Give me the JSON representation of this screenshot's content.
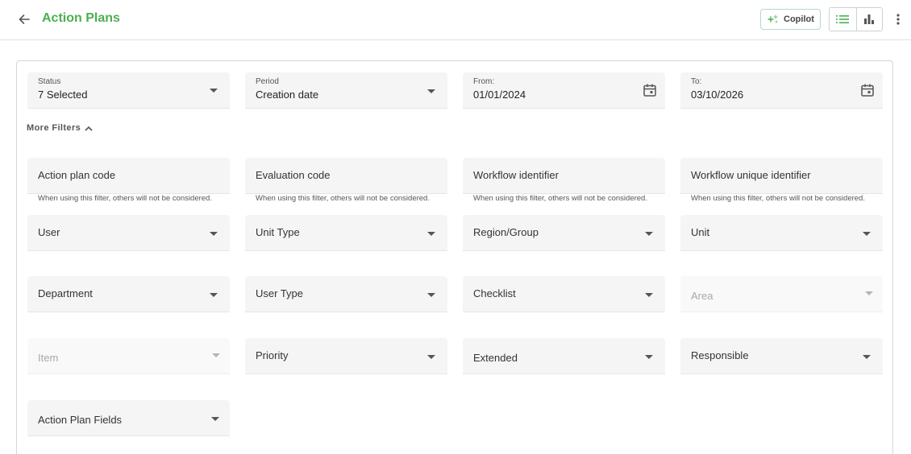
{
  "header": {
    "title": "Action Plans",
    "copilot_label": "Copilot"
  },
  "filters": {
    "status": {
      "label": "Status",
      "value": "7 Selected"
    },
    "period": {
      "label": "Period",
      "value": "Creation date"
    },
    "from": {
      "label": "From:",
      "value": "01/01/2024"
    },
    "to": {
      "label": "To:",
      "value": "03/10/2026"
    },
    "more_filters_label": "More Filters",
    "codes": [
      {
        "label": "Action plan code",
        "hint": "When using this filter, others will not be considered."
      },
      {
        "label": "Evaluation code",
        "hint": "When using this filter, others will not be considered."
      },
      {
        "label": "Workflow identifier",
        "hint": "When using this filter, others will not be considered."
      },
      {
        "label": "Workflow unique identifier",
        "hint": "When using this filter, others will not be considered."
      }
    ],
    "selects": {
      "user": "User",
      "unit_type": "Unit Type",
      "region_group": "Region/Group",
      "unit": "Unit",
      "department": "Department",
      "user_type": "User Type",
      "checklist": "Checklist",
      "area": "Area",
      "item": "Item",
      "priority": "Priority",
      "extended": "Extended",
      "responsible": "Responsible",
      "action_plan_fields": "Action Plan Fields"
    }
  },
  "colors": {
    "accent": "#4caf50",
    "field_bg": "#f5f5f5",
    "border": "#e0e0e0"
  }
}
